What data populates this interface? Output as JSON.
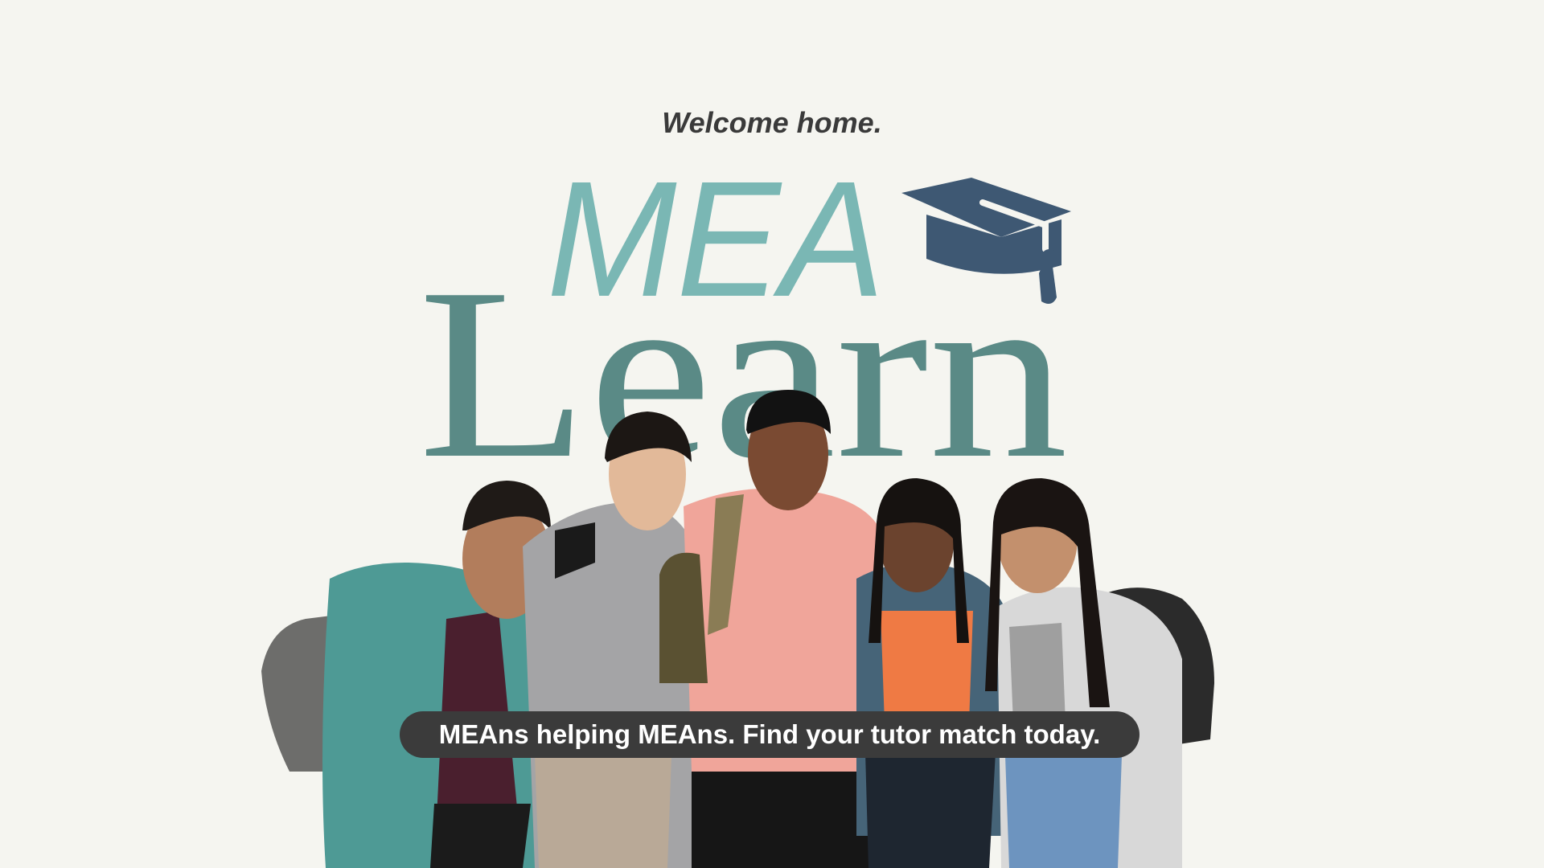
{
  "hero": {
    "tagline": "Welcome home.",
    "logo_top_word": "MEA",
    "logo_bottom_word": "Learn",
    "banner_text": "MEAns helping MEAns. Find your tutor match today.",
    "icon": "graduation-cap-icon"
  },
  "colors": {
    "background": "#f5f5f0",
    "mea_teal": "#7ab7b4",
    "learn_teal": "#5a8a86",
    "cap_navy": "#3e5873",
    "banner_bg": "#3b3b3b",
    "tagline_text": "#3a3a3a"
  }
}
